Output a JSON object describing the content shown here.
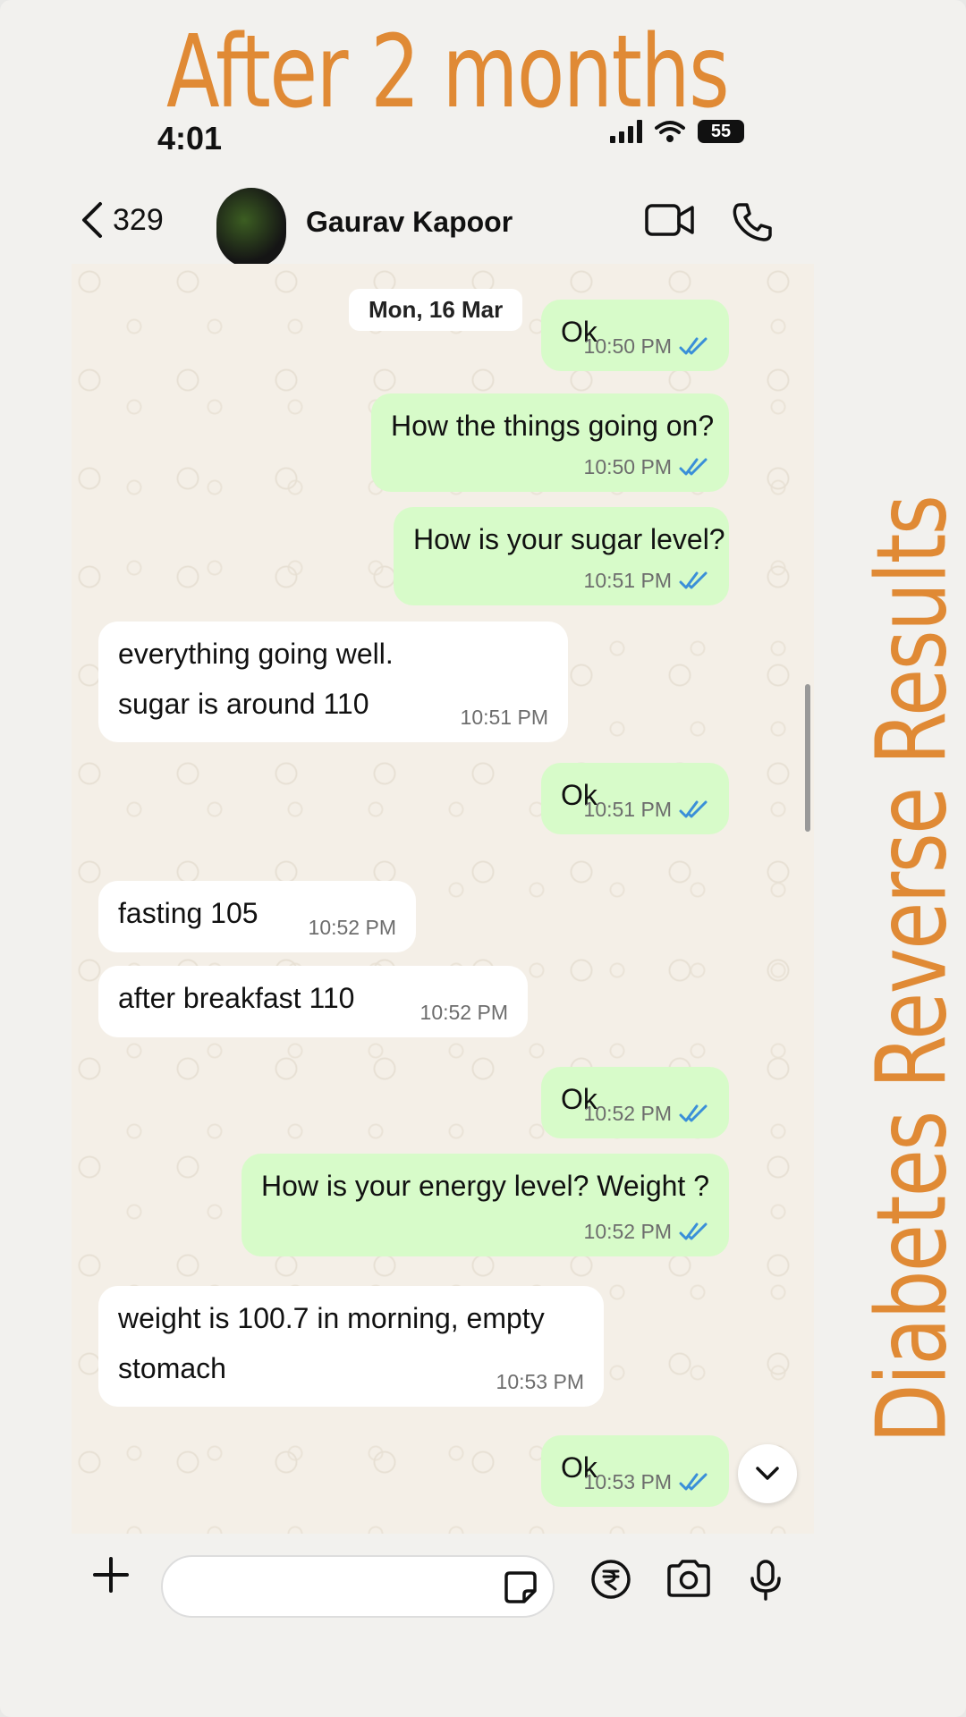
{
  "overlay": {
    "title": "After 2 months",
    "side_text": "Diabetes Reverse Results"
  },
  "status_bar": {
    "time": "4:01",
    "battery": "55"
  },
  "chat_header": {
    "back_count": "329",
    "contact_name": "Gaurav Kapoor",
    "video_icon": "video-call-icon",
    "phone_icon": "phone-call-icon"
  },
  "chat": {
    "date_chip": "Mon, 16 Mar",
    "messages": [
      {
        "dir": "out",
        "lines": [
          "Ok"
        ],
        "time": "10:50 PM",
        "read": true
      },
      {
        "dir": "out",
        "lines": [
          "How the things going on?"
        ],
        "time": "10:50 PM",
        "read": true
      },
      {
        "dir": "out",
        "lines": [
          "How is your sugar level?"
        ],
        "time": "10:51 PM",
        "read": true
      },
      {
        "dir": "in",
        "lines": [
          "everything going well.",
          "sugar is around 110"
        ],
        "time": "10:51 PM"
      },
      {
        "dir": "out",
        "lines": [
          "Ok"
        ],
        "time": "10:51 PM",
        "read": true
      },
      {
        "dir": "in",
        "lines": [
          "fasting 105"
        ],
        "time": "10:52 PM"
      },
      {
        "dir": "in",
        "lines": [
          "after breakfast 110"
        ],
        "time": "10:52 PM"
      },
      {
        "dir": "out",
        "lines": [
          "Ok"
        ],
        "time": "10:52 PM",
        "read": true
      },
      {
        "dir": "out",
        "lines": [
          "How is your energy level? Weight ?"
        ],
        "time": "10:52 PM",
        "read": true
      },
      {
        "dir": "in",
        "lines": [
          "weight is 100.7 in morning, empty",
          "stomach"
        ],
        "time": "10:53 PM"
      },
      {
        "dir": "out",
        "lines": [
          "Ok"
        ],
        "time": "10:53 PM",
        "read": true
      }
    ]
  },
  "composer": {
    "placeholder": "",
    "icons": [
      "plus-icon",
      "sticker-icon",
      "rupee-payment-icon",
      "camera-icon",
      "microphone-icon"
    ]
  },
  "colors": {
    "overlay_orange": "#e08a35",
    "outgoing_bubble": "#d7fbc9",
    "incoming_bubble": "#ffffff",
    "read_tick": "#3a8fd8"
  }
}
